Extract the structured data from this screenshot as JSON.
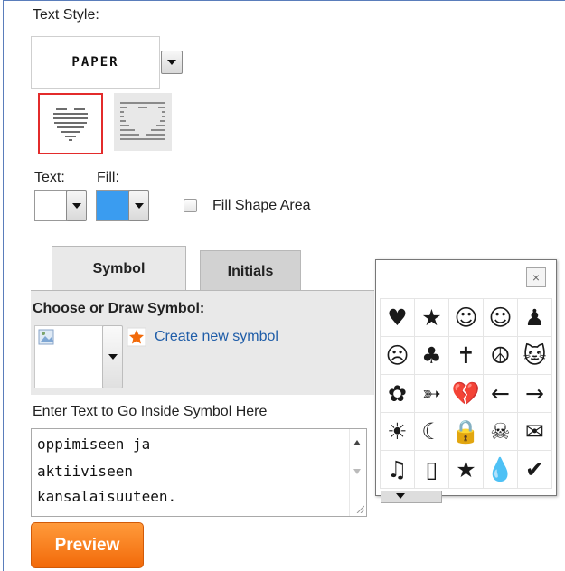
{
  "text_style": {
    "label": "Text Style:",
    "selected": "PAPER"
  },
  "colors": {
    "text_label": "Text:",
    "fill_label": "Fill:",
    "text_color": "#ffffff",
    "fill_color": "#3a9cf0"
  },
  "fill_shape": {
    "label": "Fill Shape Area",
    "checked": false
  },
  "tabs": [
    {
      "label": "Symbol",
      "active": true
    },
    {
      "label": "Initials",
      "active": false
    }
  ],
  "symbol_panel": {
    "heading": "Choose or Draw Symbol:",
    "create_link": "Create new symbol"
  },
  "text_input": {
    "label": "Enter Text to Go Inside Symbol Here",
    "lines": [
      "oppimiseen ja",
      "aktiiviseen",
      "kansalaisuuteen."
    ]
  },
  "preview_button": "Preview",
  "symbol_picker": {
    "close_glyph": "×",
    "symbols": [
      [
        "heart-icon",
        "star-icon",
        "smile-icon",
        "smile-outline-icon",
        "person-icon"
      ],
      [
        "frown-icon",
        "clover-icon",
        "cross-icon",
        "peace-icon",
        "cat-icon"
      ],
      [
        "flower-icon",
        "heart-arrow-icon",
        "broken-heart-icon",
        "arrow-left-icon",
        "arrow-right-icon"
      ],
      [
        "sun-icon",
        "moon-icon",
        "lock-icon",
        "skull-icon",
        "envelope-icon"
      ],
      [
        "music-note-icon",
        "phone-icon",
        "small-star-icon",
        "drop-icon",
        "check-icon"
      ]
    ],
    "glyphs": [
      [
        "♥",
        "★",
        "☺",
        "☺",
        "♟"
      ],
      [
        "☹",
        "♣",
        "✝",
        "☮",
        "🐱"
      ],
      [
        "✿",
        "➳",
        "💔",
        "←",
        "→"
      ],
      [
        "☀",
        "☾",
        "🔒",
        "☠",
        "✉"
      ],
      [
        "♫",
        "▯",
        "★",
        "💧",
        "✔"
      ]
    ]
  }
}
